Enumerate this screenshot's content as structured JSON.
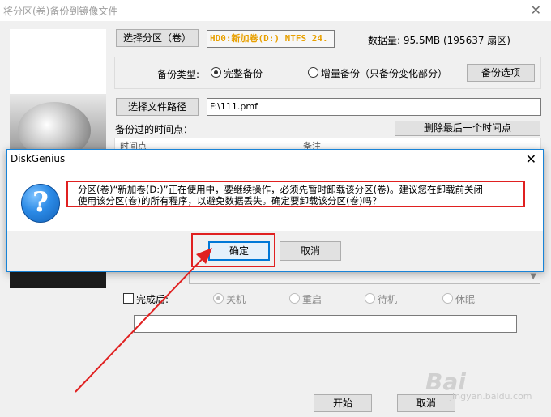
{
  "window": {
    "title": "将分区(卷)备份到镜像文件",
    "close_glyph": "✕"
  },
  "partition": {
    "button": "选择分区（卷）",
    "value": "HD0:新加卷(D:) NTFS 24.",
    "data_size": "数据量: 95.5MB (195637 扇区)"
  },
  "backup_type": {
    "label": "备份类型:",
    "full": "完整备份",
    "incremental": "增量备份（只备份变化部分）",
    "options_button": "备份选项"
  },
  "file_path": {
    "button": "选择文件路径",
    "value": "F:\\111.pmf"
  },
  "timepoints": {
    "label": "备份过的时间点：",
    "delete_button": "删除最后一个时间点",
    "col_time": "时间点",
    "col_note": "备注"
  },
  "after_finish": {
    "label": "完成后:",
    "shutdown": "关机",
    "restart": "重启",
    "standby": "待机",
    "hibernate": "休眠"
  },
  "footer": {
    "start": "开始",
    "cancel": "取消"
  },
  "dialog": {
    "title": "DiskGenius",
    "close_glyph": "✕",
    "icon_glyph": "?",
    "message_line1": "分区(卷)“新加卷(D:)”正在使用中，要继续操作，必须先暂时卸载该分区(卷)。建议您在卸载前关闭",
    "message_line2": "使用该分区(卷)的所有程序，以避免数据丢失。确定要卸载该分区(卷)吗？",
    "ok": "确定",
    "cancel": "取消"
  },
  "watermark": {
    "main": "Bai",
    "sub": "jingyan.baidu.com"
  },
  "colors": {
    "highlight": "#e02020",
    "partition_text": "#e8a000",
    "dialog_border": "#1883d7"
  }
}
